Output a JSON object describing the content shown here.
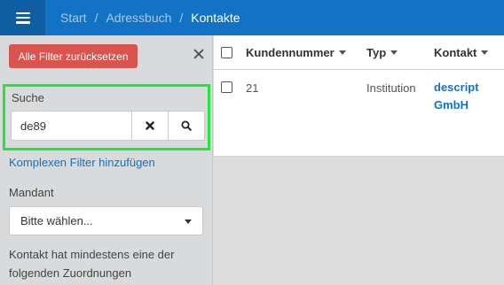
{
  "header": {
    "menu_icon": "hamburger-icon",
    "breadcrumb": [
      "Start",
      "Adressbuch",
      "Kontakte"
    ],
    "separator": "/"
  },
  "sidebar": {
    "reset_label": "Alle Filter zurücksetzen",
    "close_icon": "close-icon",
    "search": {
      "label": "Suche",
      "value": "de89",
      "clear_icon": "times-icon",
      "search_icon": "search-icon"
    },
    "complex_filter_link": "Komplexen Filter hinzufügen",
    "mandant": {
      "label": "Mandant",
      "selected": "Bitte wählen..."
    },
    "assignment_label": "Kontakt hat mindestens eine der folgenden Zuordnungen"
  },
  "table": {
    "columns": [
      "Kundennummer",
      "Typ",
      "Kontakt"
    ],
    "rows": [
      {
        "kundennummer": "21",
        "typ": "Institution",
        "kontakt_line1": "descript",
        "kontakt_line2": "GmbH"
      }
    ]
  },
  "colors": {
    "header_bg": "#1273c4",
    "reset_button": "#d9534f",
    "highlight_border": "#22e83b",
    "link": "#1273c4"
  }
}
